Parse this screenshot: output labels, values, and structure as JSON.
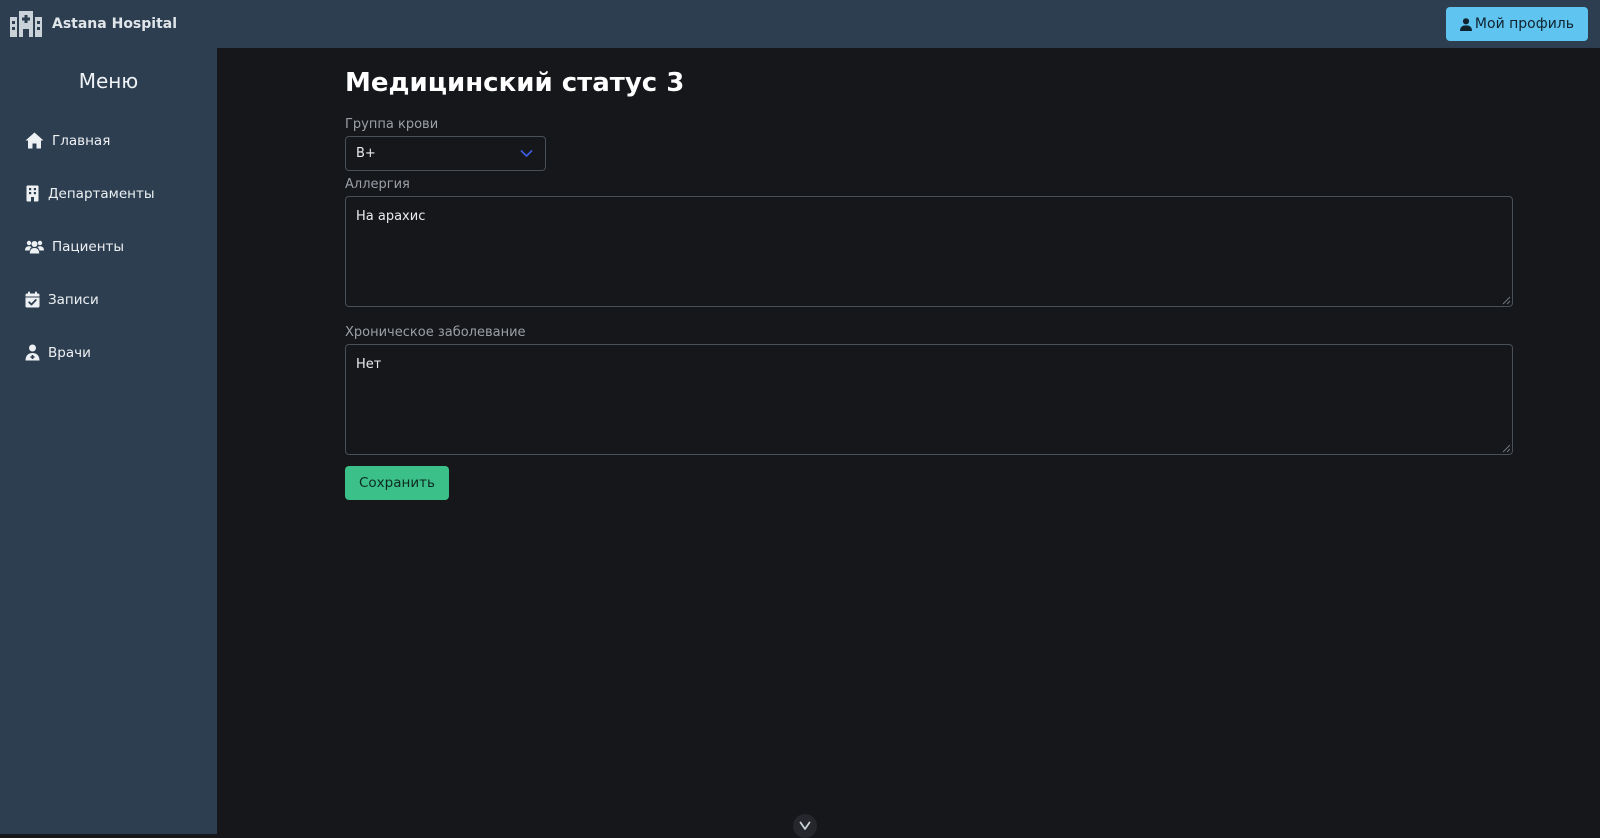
{
  "app": {
    "name": "Astana Hospital"
  },
  "header": {
    "profile_label": "Мой профиль"
  },
  "sidebar": {
    "title": "Меню",
    "items": [
      {
        "label": "Главная",
        "icon": "home-icon"
      },
      {
        "label": "Департаменты",
        "icon": "building-icon"
      },
      {
        "label": "Пациенты",
        "icon": "users-icon"
      },
      {
        "label": "Записи",
        "icon": "calendar-check-icon"
      },
      {
        "label": "Врачи",
        "icon": "doctor-icon"
      }
    ]
  },
  "form": {
    "title": "Медицинский статус 3",
    "blood_group": {
      "label": "Группа крови",
      "value": "B+"
    },
    "allergy": {
      "label": "Аллергия",
      "value": "На арахис"
    },
    "chronic": {
      "label": "Хроническое заболевание",
      "value": "Нет"
    },
    "save_label": "Сохранить"
  },
  "colors": {
    "topbar": "#2c3e50",
    "sidebar": "#2c3e50",
    "background": "#16171b",
    "profile_button": "#5fc4f0",
    "save_button": "#3cc08a",
    "select_chevron": "#3b5bdb"
  }
}
